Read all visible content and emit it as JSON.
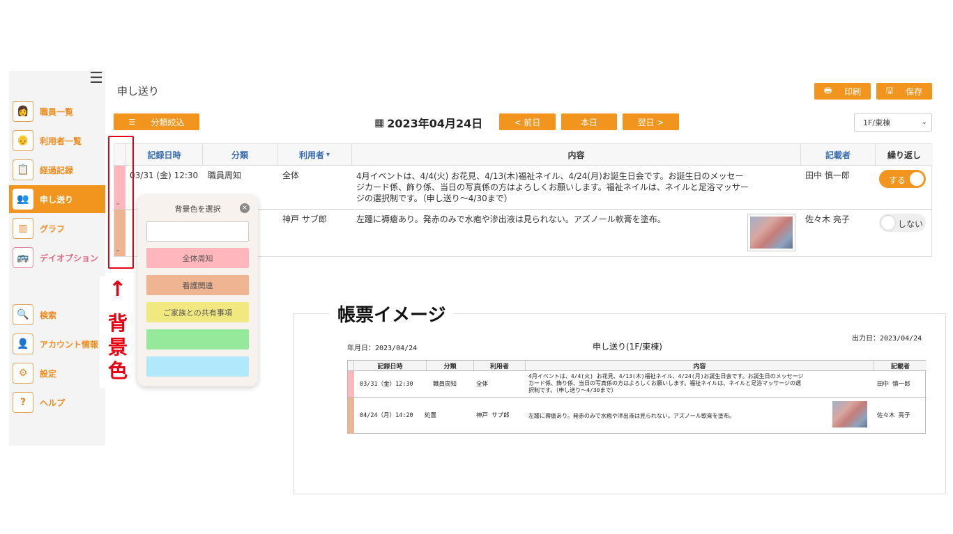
{
  "sidebar": {
    "items": [
      {
        "label": "職員一覧",
        "icon": "staff-icon"
      },
      {
        "label": "利用者一覧",
        "icon": "user-list-icon"
      },
      {
        "label": "経過記録",
        "icon": "clipboard-icon"
      },
      {
        "label": "申し送り",
        "icon": "handover-icon"
      },
      {
        "label": "グラフ",
        "icon": "bar-chart-icon"
      },
      {
        "label": "デイオプション",
        "icon": "bus-icon"
      },
      {
        "label": "検索",
        "icon": "search-icon"
      },
      {
        "label": "アカウント情報",
        "icon": "person-icon"
      },
      {
        "label": "設定",
        "icon": "gear-icon"
      },
      {
        "label": "ヘルプ",
        "icon": "help-icon"
      }
    ]
  },
  "header": {
    "title": "申し送り",
    "print_label": "印刷",
    "save_label": "保存",
    "filter_label": "分類絞込",
    "date": "2023年04月24日",
    "prev_label": "< 前日",
    "today_label": "本日",
    "next_label": "翌日 >",
    "floor": "1F/東棟"
  },
  "table": {
    "headers": [
      "記録日時",
      "分類",
      "利用者",
      "内容",
      "記載者",
      "繰り返し"
    ],
    "rows": [
      {
        "datetime": "03/31 (金) 12:30",
        "category": "職員周知",
        "user": "全体",
        "content": [
          "4月イベントは、4/4(火) お花見、4/13(木)福祉ネイル、4/24(月)お誕生日会です。お誕生日のメッセー",
          "ジカード係、飾り係、当日の写真係の方はよろしくお願いします。福祉ネイルは、ネイルと足浴マッサー",
          "ジの選択制です。（申し送り～4/30まで）"
        ],
        "author": "田中 慎一郎",
        "repeat": "する",
        "color": "#ffb6bd"
      },
      {
        "datetime": "",
        "category": "",
        "user": "神戸 サブ郎",
        "content": [
          "左踵に褥瘡あり。発赤のみで水疱や滲出液は見られない。アズノール軟膏を塗布。"
        ],
        "author": "佐々木 亮子",
        "repeat": "しない",
        "color": "#efb592"
      }
    ]
  },
  "popup": {
    "title": "背景色を選択",
    "swatches": [
      {
        "label": "",
        "color": "#ffffff"
      },
      {
        "label": "全体周知",
        "color": "#ffb6bd"
      },
      {
        "label": "看護関連",
        "color": "#efb592"
      },
      {
        "label": "ご家族との共有事項",
        "color": "#f2e880"
      },
      {
        "label": "",
        "color": "#96e89a"
      },
      {
        "label": "",
        "color": "#b2e8fb"
      }
    ]
  },
  "annotation": {
    "arrow": "↑",
    "label_chars": [
      "背",
      "景",
      "色"
    ]
  },
  "report": {
    "heading": "帳票イメージ",
    "date_label": "年月日：2023/04/24",
    "title": "申し送り(1F/東棟)",
    "output_label": "出力日：2023/04/24",
    "headers": [
      "記録日時",
      "分類",
      "利用者",
      "内容",
      "記載者"
    ],
    "rows": [
      {
        "datetime": "03/31（金）12:30",
        "category": "職員周知",
        "user": "全体",
        "content": [
          "4月イベントは、4/4(火) お花見、4/13(木)福祉ネイル、4/24(月)お誕生日会です。お誕生日のメッセージ",
          "カード係、飾り係、当日の写真係の方はよろしくお願いします。福祉ネイルは、ネイルと足浴マッサージの選",
          "択制です。（申し送り～4/30まで）"
        ],
        "author": "田中 慎一郎",
        "color": "#ffb6bd"
      },
      {
        "datetime": "04/24（月）14:20",
        "category": "処置",
        "user": "神戸 サブ郎",
        "content": [
          "左踵に褥瘡あり。発赤のみで水疱や滲出液は見られない。アズノール軟膏を塗布。"
        ],
        "author": "佐々木 亮子",
        "color": "#efb592"
      }
    ]
  },
  "colors": {
    "accent": "#f2951f",
    "annotation_red": "#e60012",
    "link_blue": "#3a6db0"
  }
}
